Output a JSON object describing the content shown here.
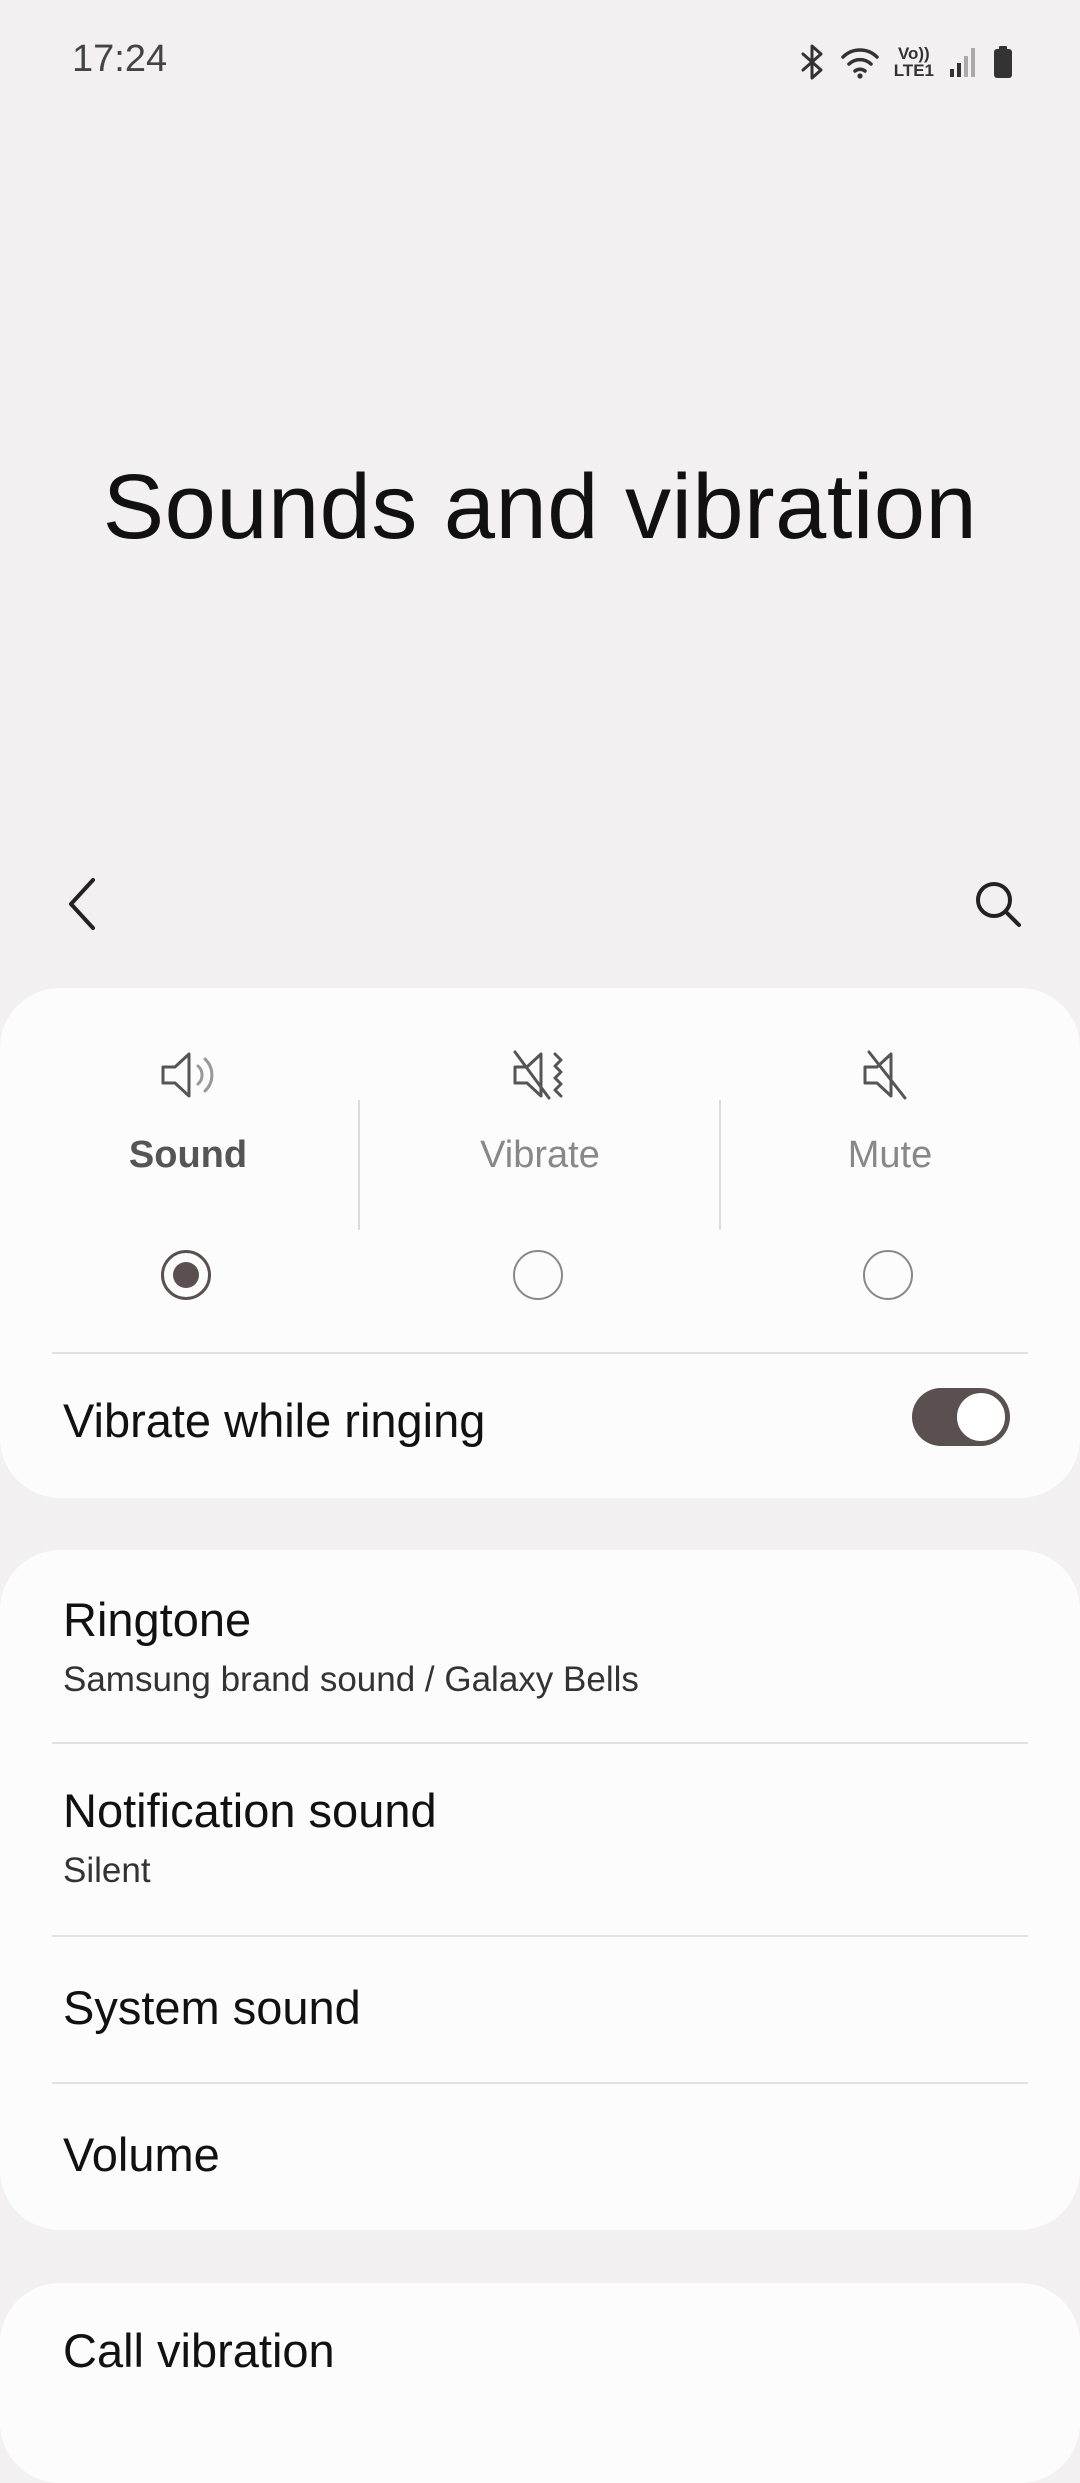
{
  "status_bar": {
    "time": "17:24",
    "lte_top": "Vo))",
    "lte_bottom": "LTE1",
    "icons": [
      "bluetooth-icon",
      "wifi-icon",
      "volte-lte-icon",
      "signal-icon",
      "battery-icon"
    ]
  },
  "header": {
    "title": "Sounds and vibration",
    "back_icon": "chevron-left-icon",
    "search_icon": "search-icon"
  },
  "sound_modes": {
    "selected": "Sound",
    "modes": [
      {
        "label": "Sound",
        "icon": "speaker-icon",
        "selected": true
      },
      {
        "label": "Vibrate",
        "icon": "vibrate-icon",
        "selected": false
      },
      {
        "label": "Mute",
        "icon": "mute-icon",
        "selected": false
      }
    ]
  },
  "vibrate_while_ringing": {
    "label": "Vibrate while ringing",
    "enabled": true
  },
  "settings_list": [
    {
      "title": "Ringtone",
      "subtitle": "Samsung brand sound / Galaxy Bells"
    },
    {
      "title": "Notification sound",
      "subtitle": "Silent"
    },
    {
      "title": "System sound"
    },
    {
      "title": "Volume"
    }
  ],
  "bottom_list": [
    {
      "title": "Call vibration"
    }
  ],
  "colors": {
    "background": "#f2f0f1",
    "card": "#fcfcfc",
    "accent": "#5a5050"
  }
}
